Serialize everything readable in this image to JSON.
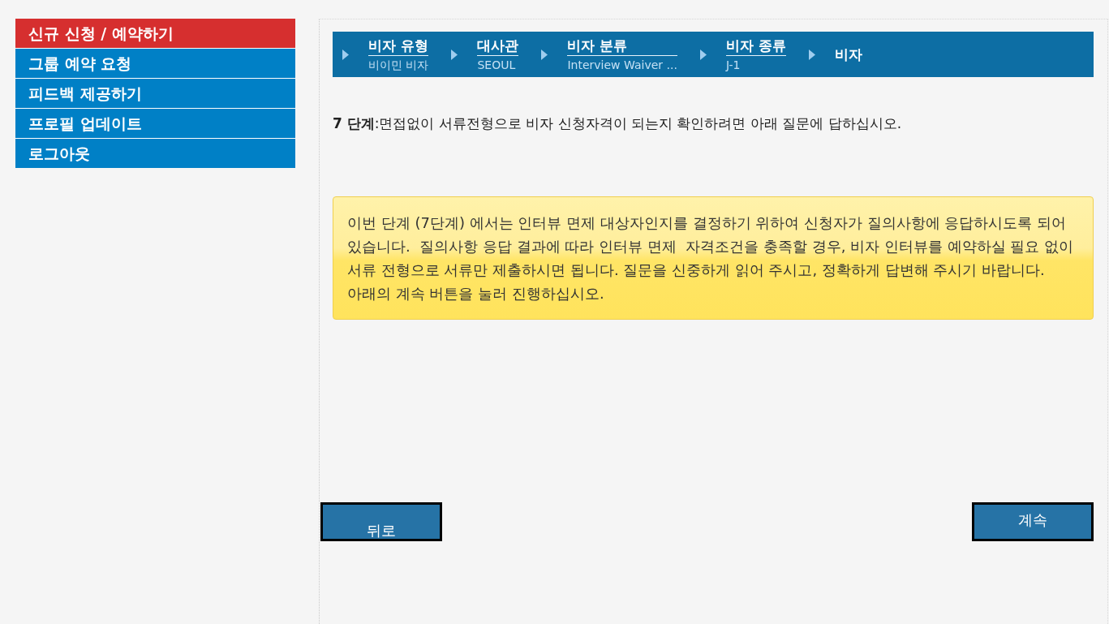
{
  "sidebar": {
    "items": [
      {
        "label": "신규 신청 / 예약하기",
        "selected": true
      },
      {
        "label": "그룹 예약 요청",
        "selected": false
      },
      {
        "label": "피드백 제공하기",
        "selected": false
      },
      {
        "label": "프로필 업데이트",
        "selected": false
      },
      {
        "label": "로그아웃",
        "selected": false
      }
    ]
  },
  "breadcrumb": {
    "steps": [
      {
        "title": "비자 유형",
        "value": "비이민 비자"
      },
      {
        "title": "대사관",
        "value": "SEOUL"
      },
      {
        "title": "비자 분류",
        "value": "Interview Waiver ..."
      },
      {
        "title": "비자 종류",
        "value": "J-1"
      },
      {
        "title": "비자"
      }
    ]
  },
  "instruction": "**7 단계**:면접없이 서류전형으로 비자 신청자격이 되는지 확인하려면 아래 질문에 답하십시오.",
  "notice": {
    "paragraphs": [
      "이번 단계 (7단계) 에서는 인터뷰 면제 대상자인지를 결정하기 위하여 신청자가 질의사항에 응답하시도록 되어 있습니다.  질의사항 응답 결과에 따라 인터뷰 면제  자격조건을 충족할 경우, 비자 인터뷰를 예약하실 필요 없이 서류 전형으로 서류만 제출하시면 됩니다. 질문을 신중하게 읽어 주시고, 정확하게 답변해 주시기 바랍니다.",
      "아래의 계속 버튼을 눌러 진행하십시오."
    ]
  },
  "buttons": [
    {
      "kind": "back",
      "label": "뒤로"
    },
    {
      "kind": "continue",
      "label": "계속"
    }
  ]
}
